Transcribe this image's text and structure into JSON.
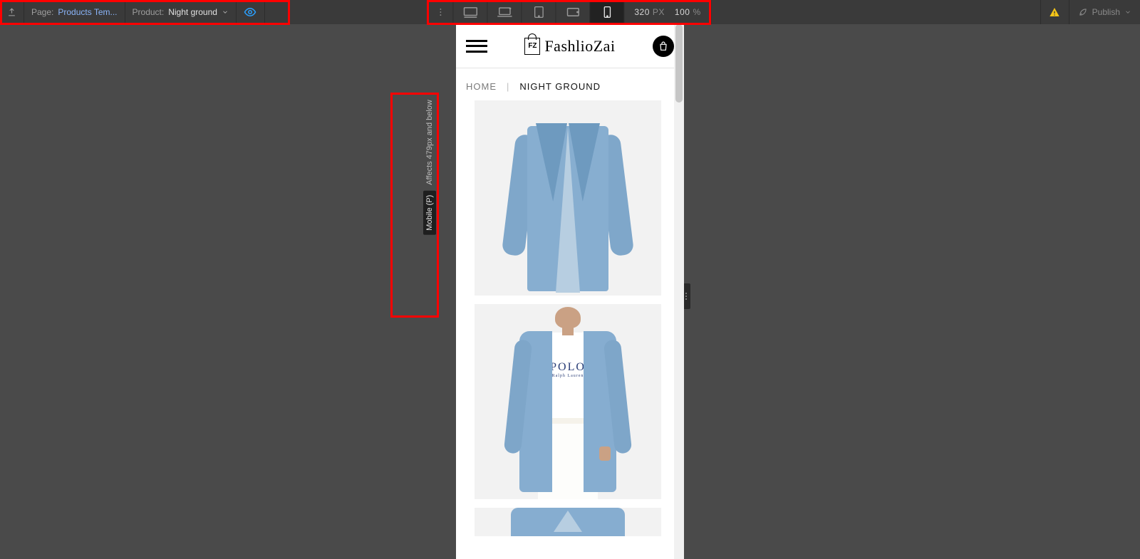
{
  "topbar": {
    "page_label": "Page:",
    "page_value": "Products Tem...",
    "product_label": "Product:",
    "product_value": "Night ground",
    "width_value": "320",
    "width_unit": "PX",
    "zoom_value": "100",
    "zoom_unit": "%",
    "publish_label": "Publish"
  },
  "breakpoint": {
    "name": "Mobile (P)",
    "affects": "Affects 479px and below"
  },
  "site": {
    "brand_mark": "FZ",
    "brand_name_a": "Fashlio",
    "brand_name_b": "Zai",
    "breadcrumbs": {
      "home": "HOME",
      "current": "NIGHT GROUND"
    },
    "model_shirt_text": "POLO",
    "model_shirt_sub": "Ralph Lauren"
  }
}
